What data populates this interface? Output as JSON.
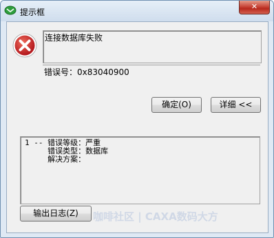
{
  "window": {
    "title": "提示框",
    "close_glyph": "✕"
  },
  "message": {
    "text": "连接数据库失败",
    "error_code": "错误号：0x83040900"
  },
  "buttons": {
    "ok_label": "确定(O)",
    "detail_label": "详细 <<",
    "export_log_label": "输出日志(Z)"
  },
  "detail": {
    "lines": [
      "1 -- 错误等级：严重",
      "     错误类型：数据库",
      "     解决方案："
    ]
  },
  "watermark": "咖啡社区 | CAXA数码大方",
  "icons": {
    "app": "app-icon",
    "error": "error-icon",
    "close": "close-icon"
  },
  "colors": {
    "error_red": "#c8262a",
    "title_bg": "#dfe9f4",
    "client_bg": "#f0f0f0"
  }
}
